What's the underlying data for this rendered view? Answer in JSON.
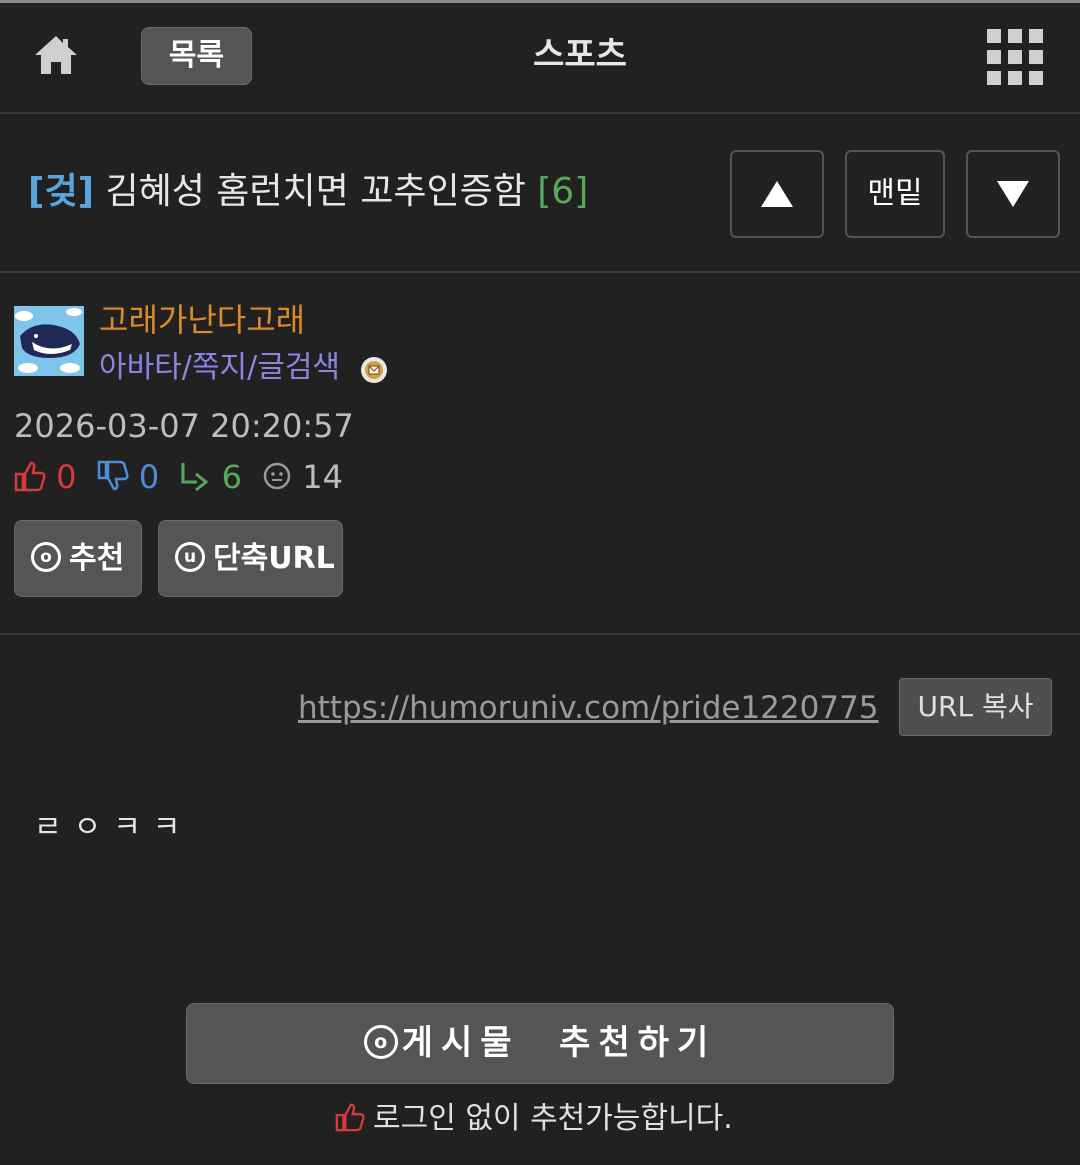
{
  "header": {
    "home_icon": "home-icon",
    "list_label": "목록",
    "section_title": "스포츠",
    "menu_icon": "grid-menu-icon"
  },
  "post": {
    "category": "[겆]",
    "title": "김혜성 홈런치면 꼬추인증함",
    "comment_count": "[6]",
    "nav_up_icon": "arrow-up-icon",
    "nav_end_label": "맨밑",
    "nav_down_icon": "arrow-down-icon"
  },
  "author": {
    "nickname": "고래가난다고래",
    "links": "아바타/쪽지/글검색",
    "badge_icon": "letter-badge-icon",
    "datetime": "2026-03-07 20:20:57",
    "stats": {
      "upvotes": "0",
      "downvotes": "0",
      "replies": "6",
      "views": "14"
    },
    "recommend_label": "추천",
    "shorturl_label": "단축URL",
    "recommend_circle": "o",
    "shorturl_circle": "u"
  },
  "body": {
    "url": "https://humoruniv.com/pride1220775",
    "copy_label": "URL 복사",
    "content": "ㄹㅇㅋㅋ"
  },
  "footer": {
    "recommend_button": "게시물  추천하기",
    "recommend_circle": "o",
    "note": "로그인 없이 추천가능합니다."
  },
  "colors": {
    "background": "#212121",
    "category": "#5aa5e0",
    "comment_count": "#58a85a",
    "nickname": "#d98b2b",
    "links": "#8b84e0",
    "upvote": "#d63a3a",
    "downvote": "#4a8fd8"
  }
}
